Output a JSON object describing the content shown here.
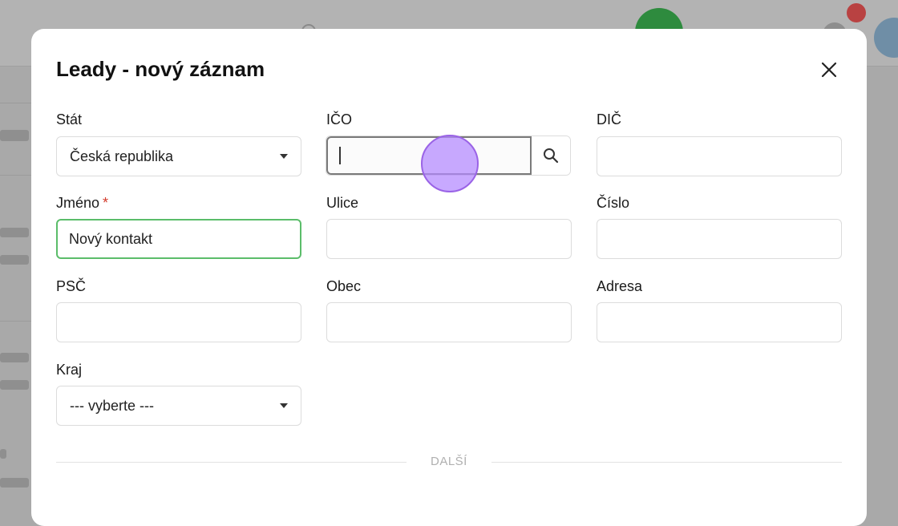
{
  "modal": {
    "title": "Leady - nový záznam"
  },
  "form": {
    "stat": {
      "label": "Stát",
      "value": "Česká republika"
    },
    "ico": {
      "label": "IČO",
      "value": ""
    },
    "dic": {
      "label": "DIČ",
      "value": ""
    },
    "jmeno": {
      "label": "Jméno",
      "required_mark": "*",
      "value": "Nový kontakt"
    },
    "ulice": {
      "label": "Ulice",
      "value": ""
    },
    "cislo": {
      "label": "Číslo",
      "value": ""
    },
    "psc": {
      "label": "PSČ",
      "value": ""
    },
    "obec": {
      "label": "Obec",
      "value": ""
    },
    "adresa": {
      "label": "Adresa",
      "value": ""
    },
    "kraj": {
      "label": "Kraj",
      "value": "--- vyberte ---"
    }
  },
  "section_divider": {
    "label": "DALŠÍ"
  },
  "icons": {
    "close": "close-icon",
    "search": "search-icon",
    "dropdown": "chevron-down-icon"
  },
  "colors": {
    "required": "#d33b2b",
    "valid_border": "#5bbd6a",
    "cursor": "#b388ff"
  }
}
